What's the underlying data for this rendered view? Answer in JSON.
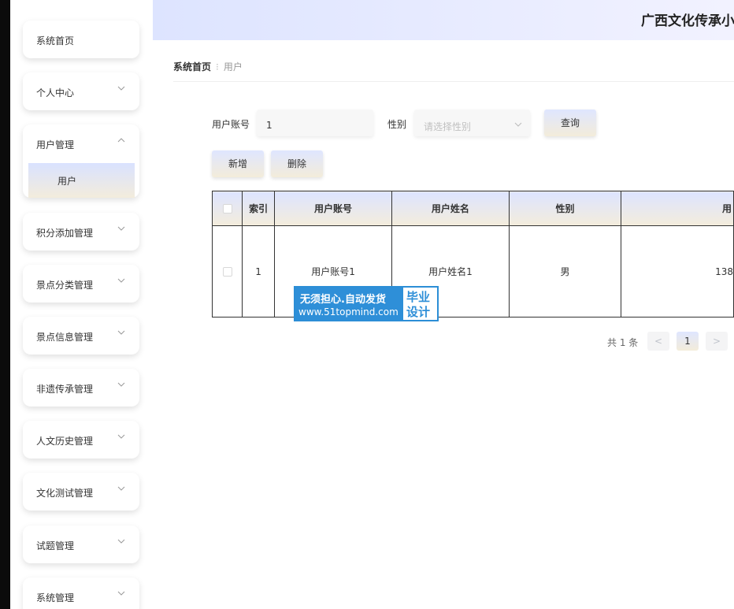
{
  "sidebar": {
    "items": [
      {
        "label": "系统首页"
      },
      {
        "label": "个人中心"
      },
      {
        "label": "用户管理",
        "sub": "用户"
      },
      {
        "label": "积分添加管理"
      },
      {
        "label": "景点分类管理"
      },
      {
        "label": "景点信息管理"
      },
      {
        "label": "非遗传承管理"
      },
      {
        "label": "人文历史管理"
      },
      {
        "label": "文化测试管理"
      },
      {
        "label": "试题管理"
      },
      {
        "label": "系统管理"
      }
    ]
  },
  "header": {
    "title": "广西文化传承小"
  },
  "breadcrumb": {
    "home": "系统首页",
    "current": "用户"
  },
  "search": {
    "account_label": "用户账号",
    "account_value": "1",
    "gender_label": "性别",
    "gender_placeholder": "请选择性别",
    "query_label": "查询"
  },
  "actions": {
    "add_label": "新增",
    "delete_label": "删除"
  },
  "table": {
    "headers": [
      "索引",
      "用户账号",
      "用户姓名",
      "性别",
      "用"
    ],
    "rows": [
      [
        "1",
        "用户账号1",
        "用户姓名1",
        "男",
        "138"
      ]
    ]
  },
  "pagination": {
    "total": "共 1 条",
    "prev": "<",
    "page": "1",
    "next": ">"
  },
  "watermark": {
    "line1": "无须担心.自动发货",
    "line2": "www.51topmind.com",
    "right1": "毕业",
    "right2": "设计"
  }
}
